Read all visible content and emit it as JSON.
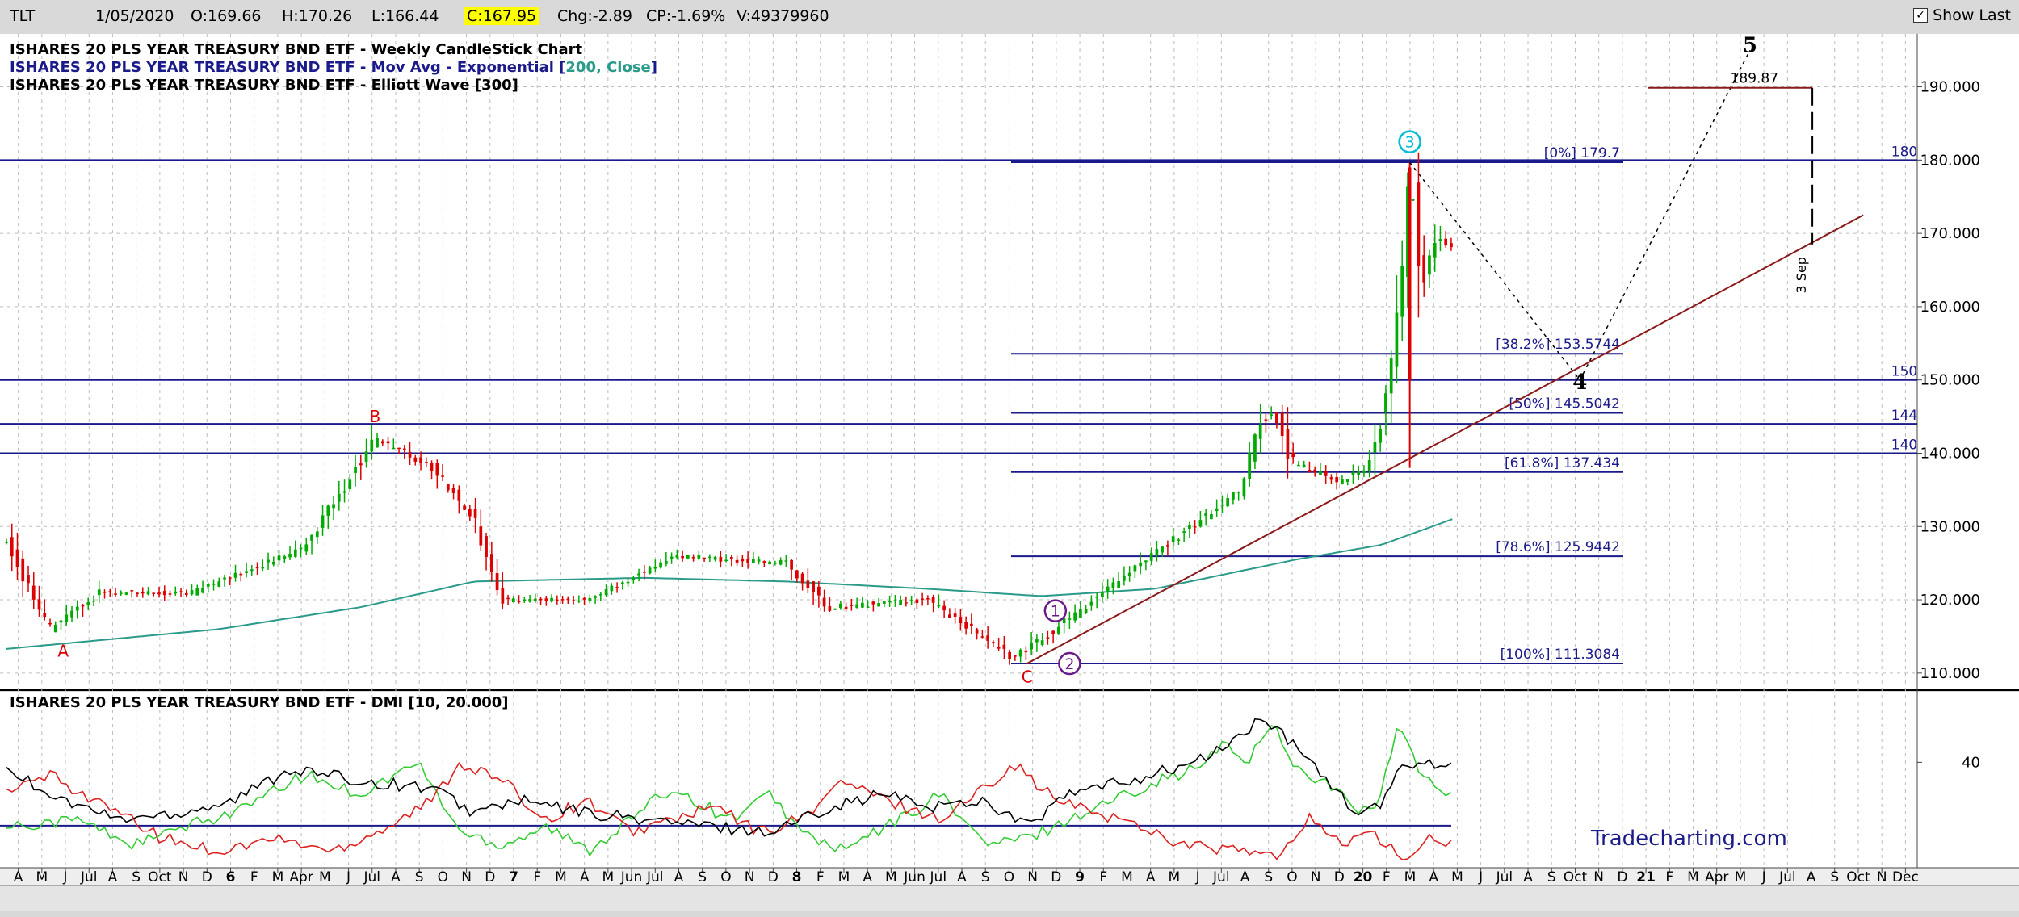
{
  "quote": {
    "symbol": "TLT",
    "date": "1/05/2020",
    "open": "O:169.66",
    "high": "H:170.26",
    "low": "L:166.44",
    "close": "C:167.95",
    "change": "Chg:-2.89",
    "change_pct": "CP:-1.69%",
    "volume": "V:49379960",
    "show_last_label": "Show Last"
  },
  "colors": {
    "background": "#ffffff",
    "up": "#00aa00",
    "down": "#dd0000",
    "ma": "#2a9a8a",
    "fib": "#1a1a8a",
    "trend": "#8b1a1a",
    "plus_di": "#33cc33",
    "minus_di": "#dd2222",
    "adx": "#000000",
    "brand": "#1a1a8a"
  },
  "chart_data": [
    {
      "type": "candlestick",
      "title_lines": [
        {
          "prefix": "ISHARES 20 PLS YEAR TREASURY BND ETF - Weekly CandleStick Chart",
          "accent": "",
          "suffix": ""
        },
        {
          "prefix": "ISHARES 20 PLS YEAR TREASURY BND ETF - Mov Avg - Exponential [",
          "accent": "200, Close",
          "suffix": "]"
        },
        {
          "prefix": "ISHARES 20 PLS YEAR TREASURY BND ETF - Elliott Wave [300]",
          "accent": "",
          "suffix": ""
        }
      ],
      "ylim": [
        108,
        197
      ],
      "y_ticks": [
        "110.000",
        "120.000",
        "130.000",
        "140.000",
        "150.000",
        "160.000",
        "170.000",
        "180.000",
        "190.000"
      ],
      "price_keypoints": [
        [
          2015.25,
          128
        ],
        [
          2015.4,
          116
        ],
        [
          2015.58,
          121
        ],
        [
          2015.9,
          121
        ],
        [
          2016.3,
          127
        ],
        [
          2016.55,
          142
        ],
        [
          2016.75,
          138
        ],
        [
          2016.9,
          131
        ],
        [
          2017.0,
          120
        ],
        [
          2017.3,
          120
        ],
        [
          2017.6,
          126
        ],
        [
          2018.0,
          125
        ],
        [
          2018.15,
          119
        ],
        [
          2018.5,
          120
        ],
        [
          2018.8,
          112
        ],
        [
          2018.95,
          116
        ],
        [
          2019.15,
          122
        ],
        [
          2019.6,
          135
        ],
        [
          2019.68,
          145
        ],
        [
          2019.72,
          146
        ],
        [
          2019.78,
          139
        ],
        [
          2019.95,
          136
        ],
        [
          2020.05,
          138
        ],
        [
          2020.12,
          148
        ],
        [
          2020.18,
          167
        ],
        [
          2020.2,
          179.7
        ],
        [
          2020.24,
          163
        ],
        [
          2020.3,
          170
        ],
        [
          2020.35,
          168
        ]
      ],
      "ma_keypoints": [
        [
          2015.25,
          113.3
        ],
        [
          2016.0,
          116
        ],
        [
          2016.5,
          119
        ],
        [
          2016.9,
          122.5
        ],
        [
          2017.5,
          123
        ],
        [
          2018.0,
          122.5
        ],
        [
          2018.5,
          121.5
        ],
        [
          2018.9,
          120.5
        ],
        [
          2019.3,
          121.5
        ],
        [
          2019.8,
          125.5
        ],
        [
          2020.1,
          127.5
        ],
        [
          2020.35,
          131
        ]
      ],
      "fib_levels": [
        {
          "label": "[0%] 179.7",
          "value": 179.7
        },
        {
          "label": "[38.2%] 153.5744",
          "value": 153.5744
        },
        {
          "label": "[50%] 145.5042",
          "value": 145.5042
        },
        {
          "label": "[61.8%] 137.434",
          "value": 137.434
        },
        {
          "label": "[78.6%] 125.9442",
          "value": 125.9442
        },
        {
          "label": "[100%] 111.3084",
          "value": 111.3084
        }
      ],
      "horizontal_levels": [
        {
          "label": "180",
          "value": 180
        },
        {
          "label": "150",
          "value": 150
        },
        {
          "label": "144",
          "value": 144
        },
        {
          "label": "140",
          "value": 140
        }
      ],
      "trendline": [
        [
          2018.85,
          111.3
        ],
        [
          2021.8,
          172.5
        ]
      ],
      "projection_path": [
        [
          2020.2,
          179.7
        ],
        [
          2020.8,
          150
        ],
        [
          2021.4,
          195
        ]
      ],
      "target": {
        "label": "189.87",
        "value": 189.87,
        "x_start": 2021.04,
        "x_end": 2021.62
      },
      "vertical_marker": {
        "label": "3 Sep",
        "x": 2021.62,
        "y_top": 189.87,
        "y_bottom": 168.5
      },
      "wave_labels": [
        {
          "label": "A",
          "x": 2015.45,
          "y": 113,
          "color": "#dd0000",
          "circled": false,
          "bold": false
        },
        {
          "label": "B",
          "x": 2016.55,
          "y": 145,
          "color": "#dd0000",
          "circled": false,
          "bold": false
        },
        {
          "label": "C",
          "x": 2018.85,
          "y": 109.5,
          "color": "#dd0000",
          "circled": false,
          "bold": false
        },
        {
          "label": "1",
          "x": 2018.95,
          "y": 118.5,
          "color": "#6a1a8a",
          "circled": true,
          "bold": false
        },
        {
          "label": "2",
          "x": 2019.0,
          "y": 111.3,
          "color": "#6a1a8a",
          "circled": true,
          "bold": false
        },
        {
          "label": "3",
          "x": 2020.2,
          "y": 182.5,
          "color": "#00bcd4",
          "circled": true,
          "bold": false
        },
        {
          "label": "4",
          "x": 2020.8,
          "y": 149.5,
          "color": "#000000",
          "circled": false,
          "bold": true
        },
        {
          "label": "5",
          "x": 2021.4,
          "y": 195.5,
          "color": "#000000",
          "circled": false,
          "bold": true
        }
      ],
      "x_axis_labels": [
        "A",
        "M",
        "J",
        "Jul",
        "A",
        "S",
        "Oct",
        "N",
        "D",
        "6",
        "F",
        "M",
        "Apr",
        "M",
        "J",
        "Jul",
        "A",
        "S",
        "O",
        "N",
        "D",
        "7",
        "F",
        "M",
        "A",
        "M",
        "Jun",
        "Jul",
        "A",
        "S",
        "O",
        "N",
        "D",
        "8",
        "F",
        "M",
        "A",
        "M",
        "Jun",
        "Jul",
        "A",
        "S",
        "O",
        "N",
        "D",
        "9",
        "F",
        "M",
        "A",
        "M",
        "J",
        "Jul",
        "A",
        "S",
        "O",
        "N",
        "D",
        "20",
        "F",
        "M",
        "A",
        "M",
        "J",
        "Jul",
        "A",
        "S",
        "Oct",
        "N",
        "D",
        "21",
        "F",
        "M",
        "Apr",
        "M",
        "J",
        "Jul",
        "A",
        "S",
        "Oct",
        "N",
        "Dec"
      ],
      "x_range": [
        2015.25,
        2021.99
      ]
    },
    {
      "type": "line",
      "title": "ISHARES 20 PLS YEAR TREASURY BND ETF - DMI [10, 20.000]",
      "y_tick": "40",
      "y_tick_value": 40,
      "ylim": [
        8,
        62
      ],
      "threshold": 20,
      "plus_di_keypoints": [
        [
          2015.25,
          20
        ],
        [
          2015.5,
          22
        ],
        [
          2015.7,
          14
        ],
        [
          2015.9,
          20
        ],
        [
          2016.1,
          26
        ],
        [
          2016.3,
          36
        ],
        [
          2016.5,
          30
        ],
        [
          2016.7,
          40
        ],
        [
          2016.85,
          18
        ],
        [
          2017.0,
          14
        ],
        [
          2017.15,
          20
        ],
        [
          2017.3,
          12
        ],
        [
          2017.45,
          22
        ],
        [
          2017.6,
          32
        ],
        [
          2017.8,
          22
        ],
        [
          2017.95,
          30
        ],
        [
          2018.05,
          18
        ],
        [
          2018.2,
          12
        ],
        [
          2018.4,
          22
        ],
        [
          2018.55,
          30
        ],
        [
          2018.7,
          14
        ],
        [
          2018.85,
          16
        ],
        [
          2019.0,
          22
        ],
        [
          2019.15,
          28
        ],
        [
          2019.3,
          34
        ],
        [
          2019.45,
          38
        ],
        [
          2019.55,
          46
        ],
        [
          2019.62,
          40
        ],
        [
          2019.72,
          52
        ],
        [
          2019.8,
          38
        ],
        [
          2019.9,
          34
        ],
        [
          2020.0,
          26
        ],
        [
          2020.08,
          24
        ],
        [
          2020.16,
          52
        ],
        [
          2020.25,
          34
        ],
        [
          2020.35,
          30
        ]
      ],
      "minus_di_keypoints": [
        [
          2015.25,
          30
        ],
        [
          2015.4,
          36
        ],
        [
          2015.6,
          26
        ],
        [
          2015.8,
          16
        ],
        [
          2016.0,
          12
        ],
        [
          2016.2,
          16
        ],
        [
          2016.4,
          12
        ],
        [
          2016.6,
          20
        ],
        [
          2016.75,
          28
        ],
        [
          2016.85,
          40
        ],
        [
          2017.0,
          34
        ],
        [
          2017.15,
          22
        ],
        [
          2017.3,
          28
        ],
        [
          2017.45,
          18
        ],
        [
          2017.6,
          22
        ],
        [
          2017.75,
          26
        ],
        [
          2017.9,
          18
        ],
        [
          2018.05,
          22
        ],
        [
          2018.2,
          34
        ],
        [
          2018.35,
          28
        ],
        [
          2018.55,
          22
        ],
        [
          2018.7,
          32
        ],
        [
          2018.8,
          40
        ],
        [
          2018.95,
          28
        ],
        [
          2019.1,
          24
        ],
        [
          2019.25,
          20
        ],
        [
          2019.4,
          14
        ],
        [
          2019.6,
          12
        ],
        [
          2019.75,
          10
        ],
        [
          2019.85,
          24
        ],
        [
          2019.95,
          14
        ],
        [
          2020.05,
          18
        ],
        [
          2020.15,
          12
        ],
        [
          2020.2,
          8
        ],
        [
          2020.25,
          16
        ],
        [
          2020.35,
          14
        ]
      ],
      "adx_keypoints": [
        [
          2015.25,
          38
        ],
        [
          2015.45,
          28
        ],
        [
          2015.65,
          22
        ],
        [
          2015.85,
          24
        ],
        [
          2016.05,
          28
        ],
        [
          2016.25,
          38
        ],
        [
          2016.5,
          34
        ],
        [
          2016.75,
          32
        ],
        [
          2016.9,
          24
        ],
        [
          2017.05,
          28
        ],
        [
          2017.3,
          24
        ],
        [
          2017.5,
          22
        ],
        [
          2017.7,
          20
        ],
        [
          2017.95,
          18
        ],
        [
          2018.15,
          26
        ],
        [
          2018.35,
          30
        ],
        [
          2018.5,
          26
        ],
        [
          2018.7,
          28
        ],
        [
          2018.85,
          20
        ],
        [
          2019.0,
          30
        ],
        [
          2019.2,
          34
        ],
        [
          2019.45,
          40
        ],
        [
          2019.6,
          48
        ],
        [
          2019.68,
          54
        ],
        [
          2019.78,
          46
        ],
        [
          2019.9,
          36
        ],
        [
          2020.0,
          24
        ],
        [
          2020.1,
          26
        ],
        [
          2020.18,
          40
        ],
        [
          2020.3,
          40
        ],
        [
          2020.35,
          39
        ]
      ],
      "brand": "Tradecharting.com"
    }
  ]
}
